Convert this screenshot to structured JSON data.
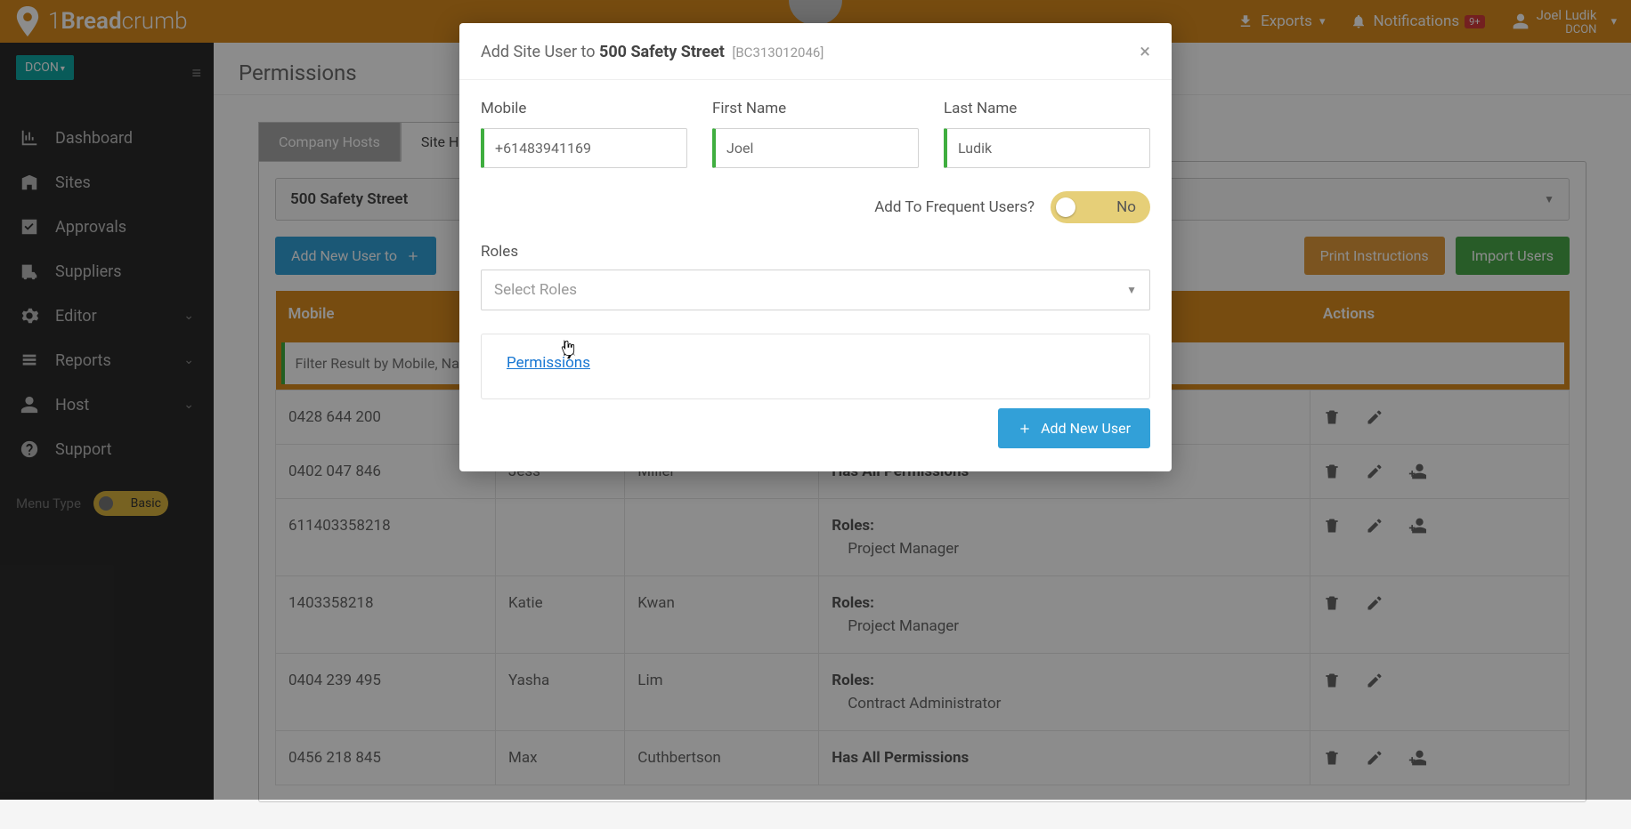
{
  "brand": {
    "part1": "1",
    "part2": "Bread",
    "part3": "crumb"
  },
  "topbar": {
    "exports": "Exports",
    "notifications": "Notifications",
    "notif_badge": "9+",
    "user_name": "Joel Ludik",
    "user_org": "DCON"
  },
  "sidebar": {
    "org_chip": "DCON",
    "items": [
      {
        "label": "Dashboard",
        "icon": "chart-icon"
      },
      {
        "label": "Sites",
        "icon": "building-icon"
      },
      {
        "label": "Approvals",
        "icon": "check-icon"
      },
      {
        "label": "Suppliers",
        "icon": "truck-icon"
      },
      {
        "label": "Editor",
        "icon": "gear-icon",
        "expandable": true
      },
      {
        "label": "Reports",
        "icon": "list-icon",
        "expandable": true
      },
      {
        "label": "Host",
        "icon": "person-icon",
        "expandable": true
      },
      {
        "label": "Support",
        "icon": "question-icon"
      }
    ],
    "menu_type_label": "Menu Type",
    "menu_type_value": "Basic"
  },
  "page": {
    "title": "Permissions",
    "tabs": {
      "company": "Company Hosts",
      "site": "Site Hosts"
    },
    "site_name": "500 Safety Street",
    "add_btn": "Add New User to",
    "print_btn": "Print Instructions",
    "import_btn": "Import Users",
    "columns": {
      "mobile": "Mobile",
      "first": "",
      "last": "",
      "perm": "",
      "actions": "Actions"
    },
    "filter_placeholder": "Filter Result by Mobile, Name",
    "rows": [
      {
        "mobile": "0428 644 200",
        "first": "",
        "last": "",
        "perm_type": "none",
        "actions": [
          "delete",
          "edit"
        ]
      },
      {
        "mobile": "0402 047 846",
        "first": "Jess",
        "last": "Miller",
        "perm_type": "all",
        "actions": [
          "delete",
          "edit",
          "adduser"
        ]
      },
      {
        "mobile": "611403358218",
        "first": "",
        "last": "",
        "perm_type": "roles",
        "roles": [
          "Project Manager"
        ],
        "actions": [
          "delete",
          "edit",
          "adduser"
        ]
      },
      {
        "mobile": "1403358218",
        "first": "Katie",
        "last": "Kwan",
        "perm_type": "roles",
        "roles": [
          "Project Manager"
        ],
        "actions": [
          "delete",
          "edit"
        ]
      },
      {
        "mobile": "0404 239 495",
        "first": "Yasha",
        "last": "Lim",
        "perm_type": "roles",
        "roles": [
          "Contract Administrator"
        ],
        "actions": [
          "delete",
          "edit"
        ]
      },
      {
        "mobile": "0456 218 845",
        "first": "Max",
        "last": "Cuthbertson",
        "perm_type": "all",
        "actions": [
          "delete",
          "edit",
          "adduser"
        ]
      }
    ],
    "roles_label_text": "Roles:",
    "all_perm_text": "Has All Permissions"
  },
  "modal": {
    "title_prefix": "Add Site User to ",
    "title_site": "500 Safety Street",
    "title_code": "[BC313012046]",
    "mobile_label": "Mobile",
    "mobile_value": "+61483941169",
    "first_label": "First Name",
    "first_value": "Joel",
    "last_label": "Last Name",
    "last_value": "Ludik",
    "freq_label": "Add To Frequent Users?",
    "freq_value": "No",
    "roles_label": "Roles",
    "roles_placeholder": "Select Roles",
    "permissions_link": "Permissions",
    "add_btn": "Add New User"
  }
}
